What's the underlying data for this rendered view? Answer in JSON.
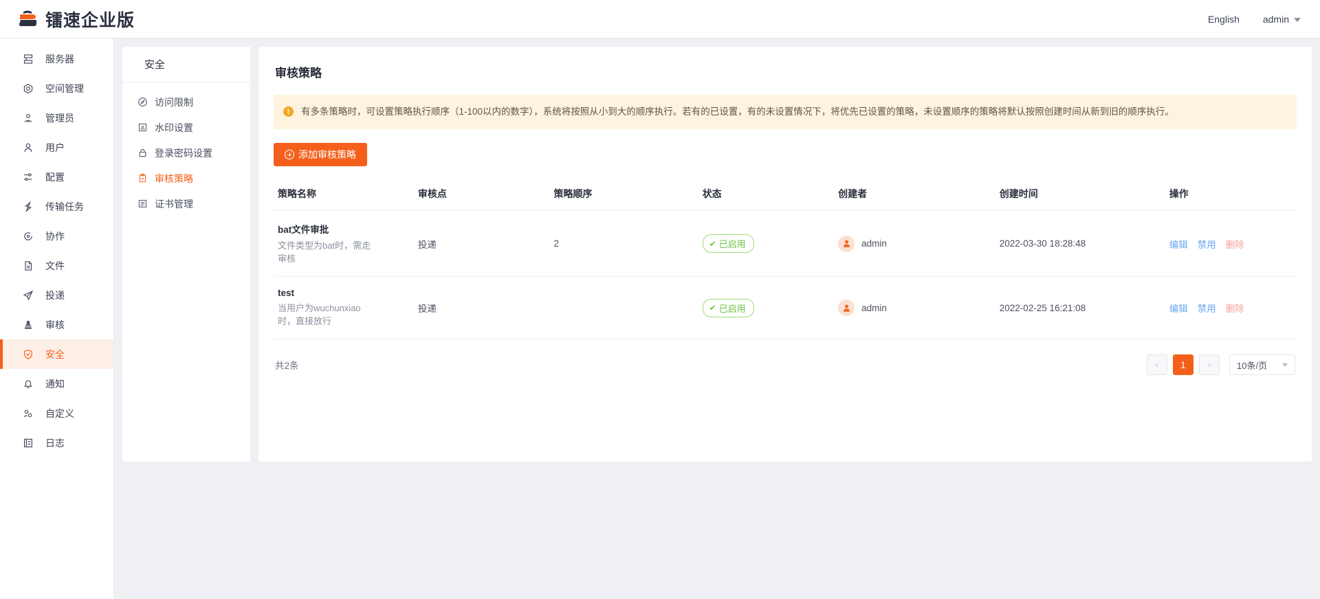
{
  "header": {
    "brand_name": "镭速企业版",
    "language": "English",
    "user": "admin"
  },
  "sidebar": {
    "items": [
      {
        "label": "服务器",
        "icon": "server-icon",
        "active": false
      },
      {
        "label": "空间管理",
        "icon": "space-icon",
        "active": false
      },
      {
        "label": "管理员",
        "icon": "admin-icon",
        "active": false
      },
      {
        "label": "用户",
        "icon": "user-icon",
        "active": false
      },
      {
        "label": "配置",
        "icon": "settings-sliders-icon",
        "active": false
      },
      {
        "label": "传输任务",
        "icon": "transfer-icon",
        "active": false
      },
      {
        "label": "协作",
        "icon": "collaboration-icon",
        "active": false
      },
      {
        "label": "文件",
        "icon": "file-icon",
        "active": false
      },
      {
        "label": "投递",
        "icon": "send-icon",
        "active": false
      },
      {
        "label": "审核",
        "icon": "stamp-icon",
        "active": false
      },
      {
        "label": "安全",
        "icon": "shield-icon",
        "active": true
      },
      {
        "label": "通知",
        "icon": "bell-icon",
        "active": false
      },
      {
        "label": "自定义",
        "icon": "customize-icon",
        "active": false
      },
      {
        "label": "日志",
        "icon": "log-icon",
        "active": false
      }
    ]
  },
  "subnav": {
    "title": "安全",
    "items": [
      {
        "label": "访问限制",
        "icon": "compass-icon",
        "active": false
      },
      {
        "label": "水印设置",
        "icon": "watermark-icon",
        "active": false
      },
      {
        "label": "登录密码设置",
        "icon": "lock-icon",
        "active": false
      },
      {
        "label": "审核策略",
        "icon": "clipboard-check-icon",
        "active": true
      },
      {
        "label": "证书管理",
        "icon": "certificate-icon",
        "active": false
      }
    ]
  },
  "main": {
    "title": "审核策略",
    "alert": {
      "icon": "warning-icon",
      "text": "有多条策略时，可设置策略执行顺序（1-100以内的数字），系统将按照从小到大的顺序执行。若有的已设置，有的未设置情况下，将优先已设置的策略，未设置顺序的策略将默认按照创建时间从新到旧的顺序执行。"
    },
    "add_button": "添加审核策略",
    "table": {
      "columns": [
        "策略名称",
        "审核点",
        "策略顺序",
        "状态",
        "创建者",
        "创建时间",
        "操作"
      ],
      "rows": [
        {
          "name": "bat文件审批",
          "desc": "文件类型为bat时，需走审核",
          "point": "投递",
          "order": "2",
          "status": "已启用",
          "creator": "admin",
          "created": "2022-03-30 18:28:48",
          "ops": [
            "编辑",
            "禁用",
            "删除"
          ]
        },
        {
          "name": "test",
          "desc": "当用户为wuchunxiao时，直接放行",
          "point": "投递",
          "order": "",
          "status": "已启用",
          "creator": "admin",
          "created": "2022-02-25 16:21:08",
          "ops": [
            "编辑",
            "禁用",
            "删除"
          ]
        }
      ]
    },
    "footer": {
      "total": "共2条",
      "prev": "‹",
      "next": "›",
      "current_page": "1",
      "page_size": "10条/页"
    }
  },
  "colors": {
    "accent": "#f4601b",
    "accent_bg": "#fdeee7",
    "alert_bg": "#fdf3df",
    "link": "#6aa9f0",
    "danger": "#f9a29b",
    "success": "#6fc243"
  }
}
